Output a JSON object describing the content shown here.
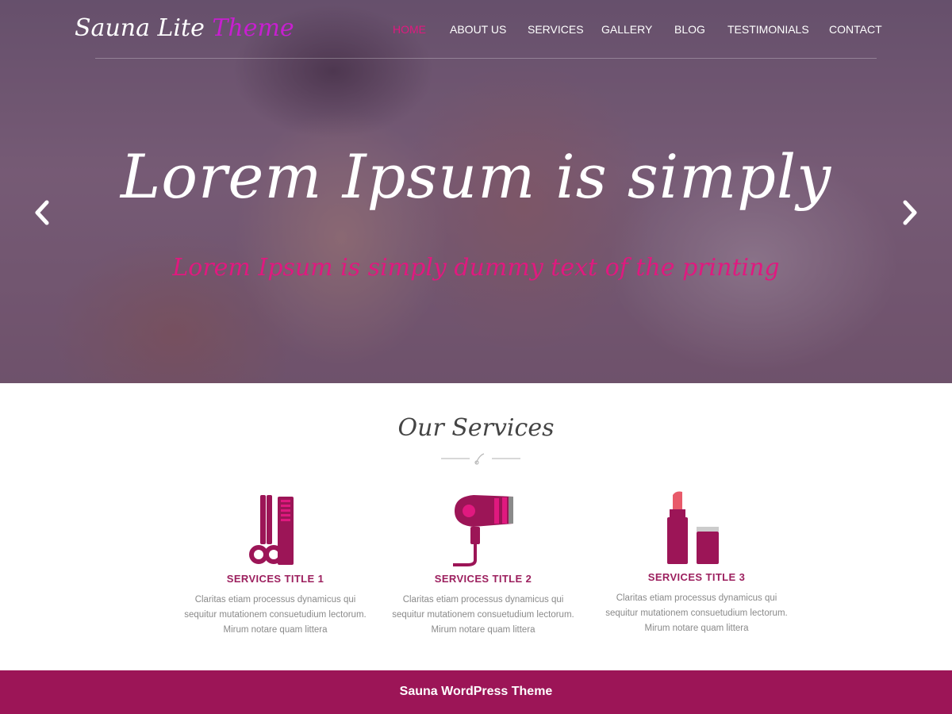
{
  "header": {
    "logo_main": "Sauna Lite",
    "logo_accent": "Theme",
    "nav": [
      {
        "label": "HOME",
        "active": true
      },
      {
        "label": "ABOUT US",
        "active": false
      },
      {
        "label": "SERVICES",
        "active": false
      },
      {
        "label": "GALLERY",
        "active": false
      },
      {
        "label": "BLOG",
        "active": false
      },
      {
        "label": "TESTIMONIALS",
        "active": false
      },
      {
        "label": "CONTACT",
        "active": false
      }
    ]
  },
  "hero": {
    "title": "Lorem Ipsum is simply",
    "subtitle": "Lorem Ipsum is simply dummy text of the printing",
    "prev_icon": "chevron-left-icon",
    "next_icon": "chevron-right-icon"
  },
  "services": {
    "heading": "Our Services",
    "divider_icon": "scissors-icon",
    "items": [
      {
        "icon": "comb-scissors-icon",
        "title": "SERVICES TITLE 1",
        "text": "Claritas etiam processus dynamicus qui sequitur mutationem consuetudium lectorum. Mirum notare quam littera"
      },
      {
        "icon": "hair-dryer-icon",
        "title": "SERVICES TITLE 2",
        "text": "Claritas etiam processus dynamicus qui sequitur mutationem consuetudium lectorum. Mirum notare quam littera"
      },
      {
        "icon": "lipstick-icon",
        "title": "SERVICES TITLE 3",
        "text": "Claritas etiam processus dynamicus qui sequitur mutationem consuetudium lectorum. Mirum notare quam littera"
      }
    ]
  },
  "footer": {
    "text": "Sauna WordPress Theme"
  },
  "colors": {
    "accent": "#9c1557",
    "nav_active": "#e0197f",
    "logo_accent": "#c71fd0"
  }
}
